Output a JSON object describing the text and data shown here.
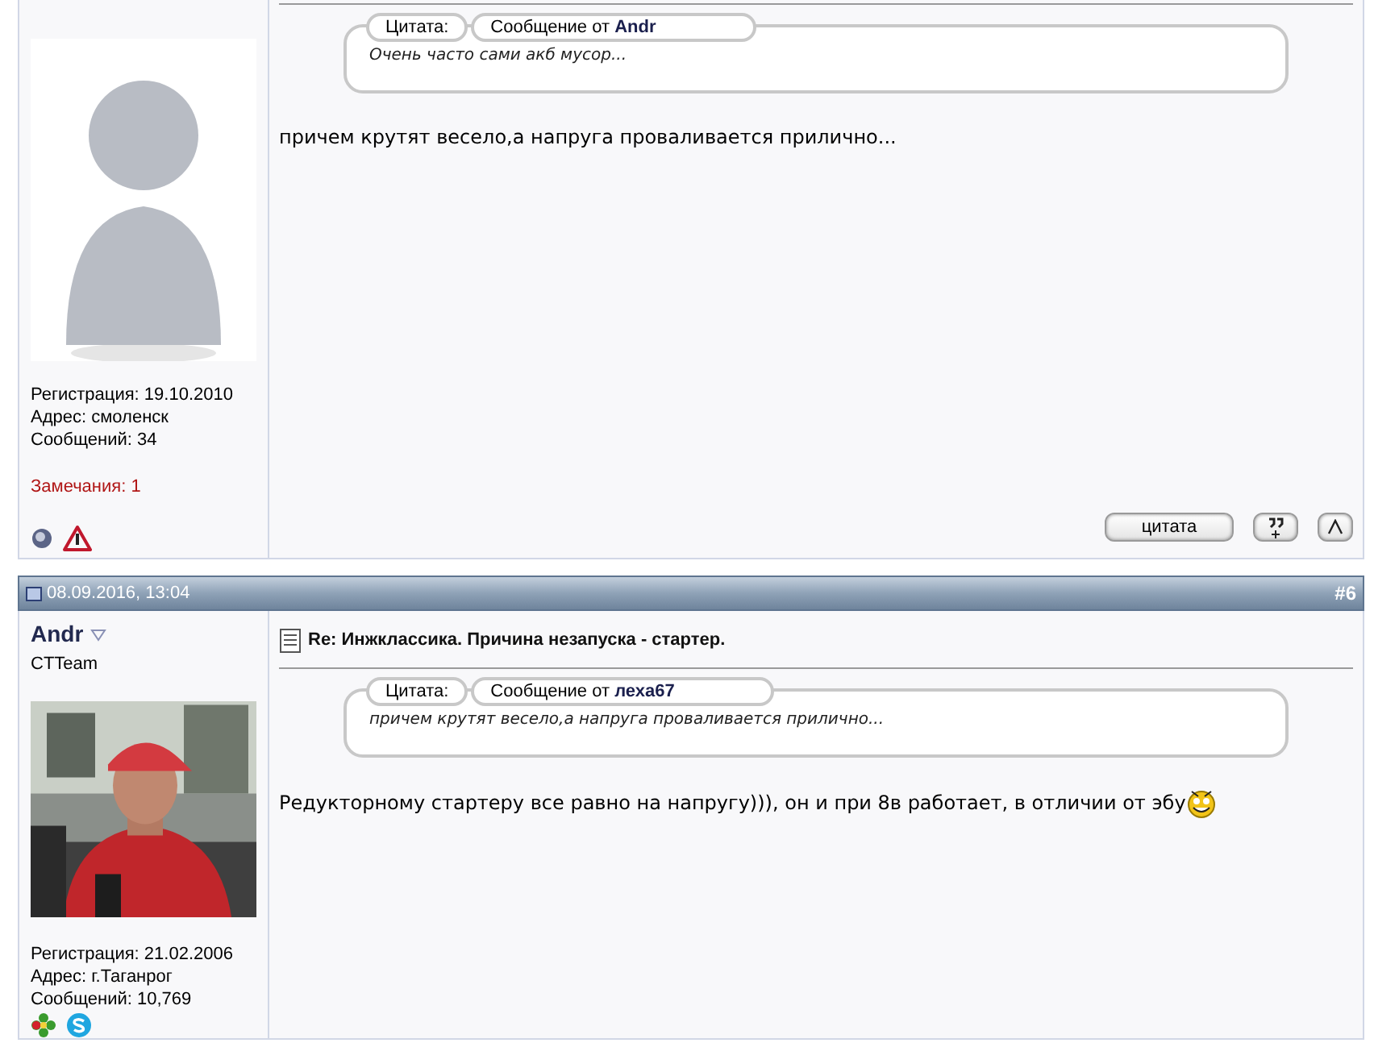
{
  "posts": [
    {
      "user": {
        "details": [
          "Регистрация: 19.10.2010",
          "Адрес: смоленск",
          "Сообщений: 34"
        ],
        "warnings": "Замечания: 1",
        "online": false,
        "contacts": [
          {
            "kind": "warning"
          }
        ]
      },
      "quote": {
        "label": "Цитата:",
        "source": "Сообщение от **Andr**",
        "text": "Очень часто сами акб мусор..."
      },
      "message": "причем крутят весело,а напруга проваливается прилично...",
      "smiley": false,
      "buttons": [
        {
          "kind": "text",
          "label": "цитата"
        },
        {
          "kind": "multiquote"
        },
        {
          "kind": "top"
        }
      ]
    },
    {
      "header": {
        "date": "08.09.2016, 13:04",
        "number": "#6"
      },
      "user": {
        "name": "Andr",
        "rank": "CTTeam",
        "details": [
          "Регистрация: 21.02.2006",
          "Адрес: г.Таганрог",
          "Сообщений: 10,769"
        ],
        "contacts": [
          {
            "kind": "icq"
          },
          {
            "kind": "skype"
          }
        ]
      },
      "title": "Re: Инжклассика. Причина незапуска - стартер.",
      "quote": {
        "label": "Цитата:",
        "source": "Сообщение от **леха67**",
        "text": "причем крутят весело,а напруга проваливается прилично..."
      },
      "message": "Редукторному стартеру все равно на напругу))), он и при 8в работает, в отличии от эбу",
      "smiley": true
    }
  ]
}
